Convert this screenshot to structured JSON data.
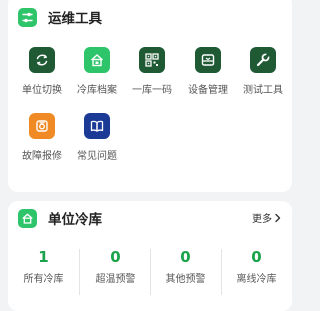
{
  "ops_tools": {
    "title": "运维工具",
    "icon": "sliders-icon",
    "accent": "#2ec46a",
    "items": [
      {
        "label": "单位切换",
        "icon": "switch-icon",
        "color": "#1f5a35"
      },
      {
        "label": "冷库档案",
        "icon": "home-folder-icon",
        "color": "#2ec46a"
      },
      {
        "label": "一库一码",
        "icon": "qr-code-icon",
        "color": "#1f5a35"
      },
      {
        "label": "设备管理",
        "icon": "device-box-icon",
        "color": "#1f5a35"
      },
      {
        "label": "测试工具",
        "icon": "wrench-icon",
        "color": "#1f5a35"
      },
      {
        "label": "故障报修",
        "icon": "repair-icon",
        "color": "#f08a24"
      },
      {
        "label": "常见问题",
        "icon": "book-icon",
        "color": "#1a3a96"
      }
    ]
  },
  "unit_cold_storage": {
    "title": "单位冷库",
    "icon": "home-icon",
    "more_label": "更多",
    "stat_color": "#1aa34a",
    "stats": [
      {
        "value": "1",
        "label": "所有冷库"
      },
      {
        "value": "0",
        "label": "超温预警"
      },
      {
        "value": "0",
        "label": "其他预警"
      },
      {
        "value": "0",
        "label": "离线冷库"
      }
    ]
  }
}
